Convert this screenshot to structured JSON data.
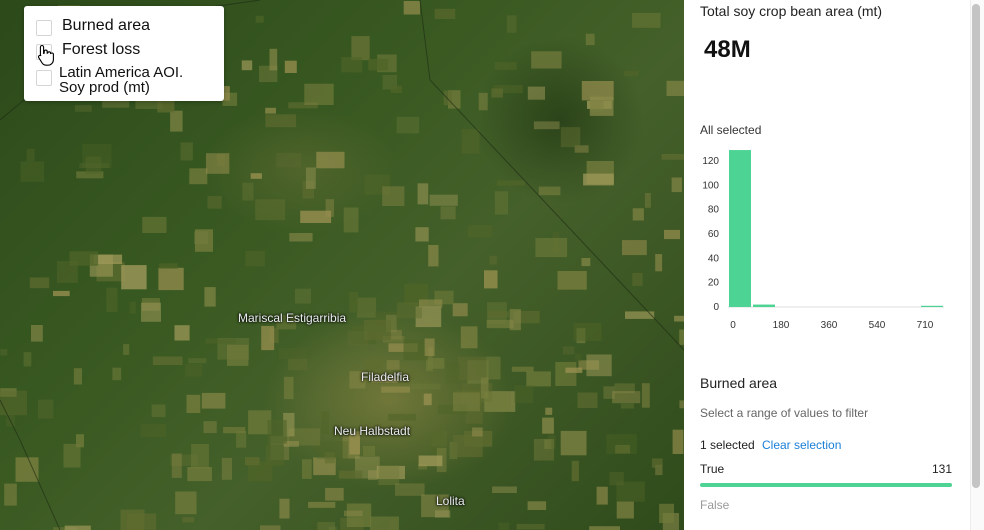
{
  "legend": {
    "items": [
      {
        "label": "Burned area",
        "checked": false
      },
      {
        "label": "Forest loss",
        "checked": false
      },
      {
        "label": "Latin America AOI.",
        "label2": "Soy prod (mt)",
        "checked": false
      }
    ]
  },
  "map": {
    "labels": [
      {
        "text": "Mariscal Estigarribia"
      },
      {
        "text": "Filadelfia"
      },
      {
        "text": "Neu Halbstadt"
      },
      {
        "text": "Lolita"
      }
    ]
  },
  "panel": {
    "widget1": {
      "title": "Total soy crop bean area (mt)",
      "value": "48M",
      "selection": "All selected"
    },
    "widget2": {
      "title": "Burned area",
      "help": "Select a range of values to filter",
      "selected_count": "1 selected",
      "clear_label": "Clear selection",
      "categories": [
        {
          "label": "True",
          "count": "131",
          "share": 1.0
        },
        {
          "label": "False",
          "count": ""
        }
      ]
    }
  },
  "colors": {
    "accent": "#4dd394",
    "link": "#1a7fd6"
  },
  "chart_data": {
    "type": "bar",
    "x_ticks": [
      "0",
      "180",
      "360",
      "540",
      "710"
    ],
    "y_ticks": [
      "0",
      "20",
      "40",
      "60",
      "80",
      "100",
      "120"
    ],
    "ylim": [
      0,
      120
    ],
    "values": [
      129,
      2,
      0,
      0,
      0,
      0,
      0,
      0,
      1
    ],
    "grid": false
  }
}
